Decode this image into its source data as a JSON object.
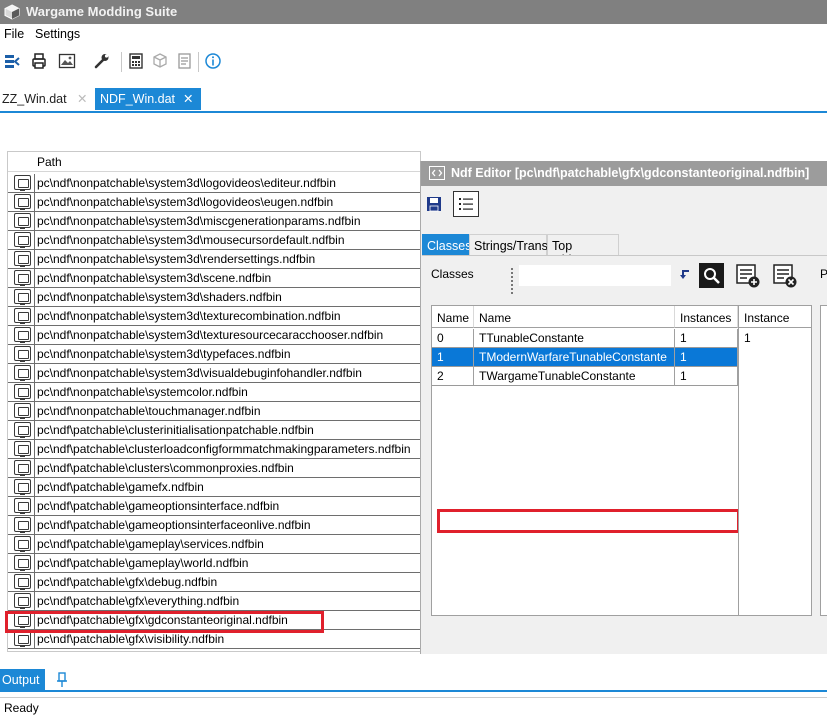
{
  "app": {
    "title": "Wargame Modding Suite"
  },
  "menu": {
    "file": "File",
    "settings": "Settings"
  },
  "tabs": {
    "zz": "ZZ_Win.dat",
    "ndf": "NDF_Win.dat"
  },
  "file_list": {
    "header": "Path",
    "rows": [
      "pc\\ndf\\nonpatchable\\system3d\\logovideos\\editeur.ndfbin",
      "pc\\ndf\\nonpatchable\\system3d\\logovideos\\eugen.ndfbin",
      "pc\\ndf\\nonpatchable\\system3d\\miscgenerationparams.ndfbin",
      "pc\\ndf\\nonpatchable\\system3d\\mousecursordefault.ndfbin",
      "pc\\ndf\\nonpatchable\\system3d\\rendersettings.ndfbin",
      "pc\\ndf\\nonpatchable\\system3d\\scene.ndfbin",
      "pc\\ndf\\nonpatchable\\system3d\\shaders.ndfbin",
      "pc\\ndf\\nonpatchable\\system3d\\texturecombination.ndfbin",
      "pc\\ndf\\nonpatchable\\system3d\\texturesourcecaracchooser.ndfbin",
      "pc\\ndf\\nonpatchable\\system3d\\typefaces.ndfbin",
      "pc\\ndf\\nonpatchable\\system3d\\visualdebuginfohandler.ndfbin",
      "pc\\ndf\\nonpatchable\\systemcolor.ndfbin",
      "pc\\ndf\\nonpatchable\\touchmanager.ndfbin",
      "pc\\ndf\\patchable\\clusterinitialisationpatchable.ndfbin",
      "pc\\ndf\\patchable\\clusterloadconfigformmatchmakingparameters.ndfbin",
      "pc\\ndf\\patchable\\clusters\\commonproxies.ndfbin",
      "pc\\ndf\\patchable\\gamefx.ndfbin",
      "pc\\ndf\\patchable\\gameoptionsinterface.ndfbin",
      "pc\\ndf\\patchable\\gameoptionsinterfaceonlive.ndfbin",
      "pc\\ndf\\patchable\\gameplay\\services.ndfbin",
      "pc\\ndf\\patchable\\gameplay\\world.ndfbin",
      "pc\\ndf\\patchable\\gfx\\debug.ndfbin",
      "pc\\ndf\\patchable\\gfx\\everything.ndfbin",
      "pc\\ndf\\patchable\\gfx\\gdconstanteoriginal.ndfbin",
      "pc\\ndf\\patchable\\gfx\\visibility.ndfbin"
    ]
  },
  "ndf_editor": {
    "title": "Ndf Editor [pc\\ndf\\patchable\\gfx\\gdconstanteoriginal.ndfbin]",
    "tabs": [
      "Classes",
      "Strings/Trans",
      "Top Objects"
    ],
    "classes_label": "Classes",
    "search_value": "",
    "grid": {
      "headers": [
        "Name",
        "Name",
        "Instances"
      ],
      "rows": [
        [
          "0",
          "TTunableConstante",
          "1"
        ],
        [
          "1",
          "TModernWarfareTunableConstante",
          "1"
        ],
        [
          "2",
          "TWargameTunableConstante",
          "1"
        ]
      ]
    },
    "instance_grid": {
      "header": "Instance",
      "rows": [
        "1"
      ]
    },
    "right_partial": "P"
  },
  "output": {
    "label": "Output"
  },
  "status": {
    "text": "Ready"
  },
  "colors": {
    "accent": "#1c88d6",
    "highlight": "#e0202c",
    "titlebar": "#808080"
  }
}
